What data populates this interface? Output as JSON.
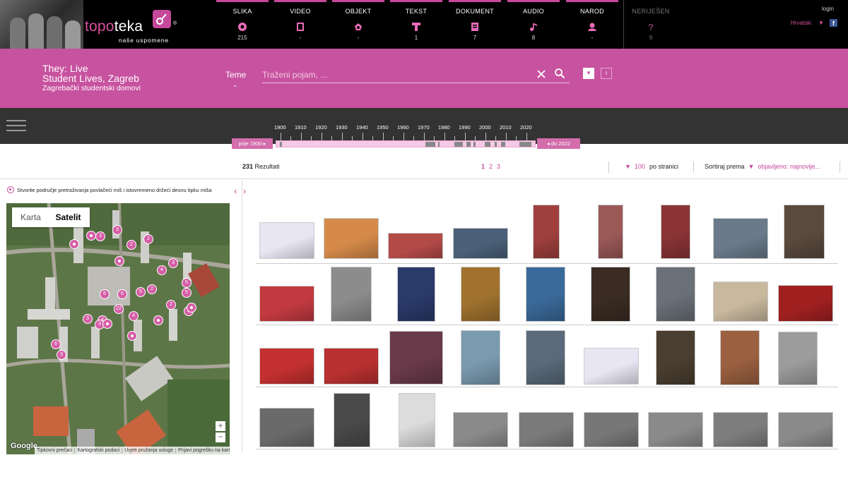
{
  "brand": {
    "name_pink": "topo",
    "name_white": "teka",
    "tagline": "naše uspomene",
    "reg": "®"
  },
  "nav": [
    {
      "label": "SLIKA",
      "count": "215",
      "icon": "image-icon",
      "color": "#e86cb8"
    },
    {
      "label": "VIDEO",
      "count": "-",
      "icon": "film-icon",
      "color": "#e86cb8"
    },
    {
      "label": "OBJEKT",
      "count": "-",
      "icon": "object-icon",
      "color": "#e86cb8"
    },
    {
      "label": "TEKST",
      "count": "1",
      "icon": "text-icon",
      "color": "#e86cb8"
    },
    {
      "label": "DOKUMENT",
      "count": "7",
      "icon": "document-icon",
      "color": "#e86cb8"
    },
    {
      "label": "AUDIO",
      "count": "8",
      "icon": "music-icon",
      "color": "#e86cb8"
    },
    {
      "label": "NAROD",
      "count": "-",
      "icon": "person-icon",
      "color": "#e86cb8"
    },
    {
      "label": "NERIJEŠEN",
      "count": "9",
      "icon": "question-icon",
      "color": "#7a3a62"
    }
  ],
  "account": {
    "login": "login",
    "language": "Hrvatski"
  },
  "project": {
    "title_line1": "They: Live",
    "title_line2": "Student Lives, Zagreb",
    "subtitle": "Zagrebački studentski domovi"
  },
  "search": {
    "teme_label": "Teme",
    "placeholder": "Traženi pojam, ...",
    "info": "i"
  },
  "timeline": {
    "years": [
      "1900",
      "1910",
      "1920",
      "1930",
      "1940",
      "1950",
      "1960",
      "1970",
      "1980",
      "1990",
      "2000",
      "2010",
      "2020"
    ],
    "from": "prije 1900",
    "to": "do 2022"
  },
  "results": {
    "count": "231",
    "count_label": "Rezultati",
    "pages": [
      "1",
      "2",
      "3"
    ],
    "current_page": "1",
    "per_page": "100",
    "per_page_label": "po stranici",
    "sort_label": "Sortiraj prema",
    "sort_value": "objavljeno: najnovije..."
  },
  "map": {
    "hint": "Stvorite područje pretraživanja povlačeći miš i istovremeno držeći desnu tipku miša",
    "type_map": "Karta",
    "type_satellite": "Satelit",
    "zoom_in": "+",
    "zoom_out": "−",
    "google": "Google",
    "footer": [
      "Tipkovni prečaci",
      "Kartografski podaci",
      "Uvjeti pružanja usluge",
      "Prijavi pogrešku na karti"
    ],
    "pins": [
      "3",
      "3",
      "2",
      "2",
      "4",
      "3",
      "5",
      "5",
      "6",
      "6",
      "5",
      "2",
      "22",
      "4",
      "2",
      "3",
      "3",
      "4",
      "6",
      "3",
      "3"
    ]
  },
  "thumbnails": {
    "rows": 4,
    "per_row": 9,
    "colors": [
      "#e9e6f4",
      "#d58a4a",
      "#b24a48",
      "#4a6078",
      "#a0403e",
      "#9b5a58",
      "#8a3436",
      "#6a7a8a",
      "#5a4a3e",
      "#c23a40",
      "#8c8c8c",
      "#2a3a6a",
      "#a0722e",
      "#3a6a9a",
      "#3a2c22",
      "#6a7078",
      "#c8b89e",
      "#a02020",
      "#c23030",
      "#b83030",
      "#6a3a4a",
      "#7a9ab0",
      "#5a6a7a",
      "#e9e6f4",
      "#4a3e30",
      "#9a6040",
      "#9c9c9c",
      "#6a6a6a",
      "#4a4a4a",
      "#dcdcdc",
      "#8a8a8a",
      "#7a7a7a",
      "#777",
      "#8a8a8a",
      "#7d7d7d",
      "#8a8a8a"
    ]
  }
}
